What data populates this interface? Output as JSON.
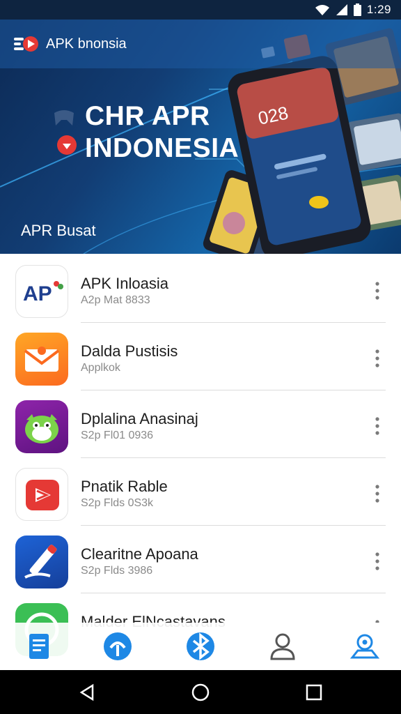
{
  "status_bar": {
    "time": "1:29"
  },
  "hero": {
    "brand_name": "APK bnonsia",
    "headline_line1": "CHR APR",
    "headline_line2": "INDONESIA",
    "subtitle": "APR Busat",
    "phone_screen_text": "028"
  },
  "apps": [
    {
      "title": "APK Inloasia",
      "subtitle": "A2p Mat 8833",
      "icon": "ap-logo-icon"
    },
    {
      "title": "Dalda Pustisis",
      "subtitle": "Applkok",
      "icon": "mail-envelope-icon"
    },
    {
      "title": "Dplalina Anasinaj",
      "subtitle": "S2p Fl01 0936",
      "icon": "green-monster-icon"
    },
    {
      "title": "Pnatik Rable",
      "subtitle": "S2p Flds 0S3k",
      "icon": "play-button-icon"
    },
    {
      "title": "Clearitne Apoana",
      "subtitle": "S2p Flds 3986",
      "icon": "pencil-icon"
    },
    {
      "title": "Malder ElNcastavans",
      "subtitle": "",
      "icon": "green-circle-icon"
    }
  ],
  "bottom_nav": [
    "document-icon",
    "cloud-upload-icon",
    "bluetooth-icon",
    "profile-icon",
    "location-pin-icon"
  ],
  "system_nav": [
    "back-icon",
    "home-icon",
    "recents-icon"
  ],
  "colors": {
    "hero_dark": "#0c2a55",
    "hero_accent": "#1565a8",
    "nav_blue": "#1e88e5",
    "text_primary": "#1d1d1d",
    "text_secondary": "#8a8a8a"
  }
}
